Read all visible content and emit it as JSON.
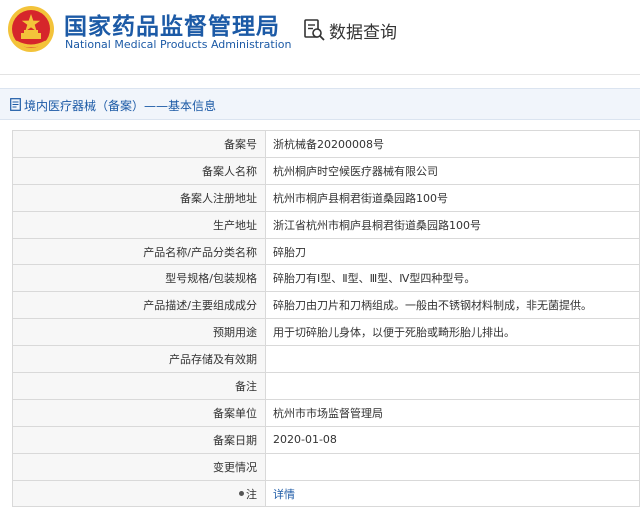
{
  "header": {
    "title_cn": "国家药品监督管理局",
    "title_en": "National Medical Products Administration",
    "query_label": "数据查询"
  },
  "breadcrumb": {
    "text": "境内医疗器械（备案）——基本信息"
  },
  "table": {
    "rows": [
      {
        "label": "备案号",
        "value": "浙杭械备20200008号"
      },
      {
        "label": "备案人名称",
        "value": "杭州桐庐时空候医疗器械有限公司"
      },
      {
        "label": "备案人注册地址",
        "value": "杭州市桐庐县桐君街道桑园路100号"
      },
      {
        "label": "生产地址",
        "value": "浙江省杭州市桐庐县桐君街道桑园路100号"
      },
      {
        "label": "产品名称/产品分类名称",
        "value": "碎胎刀"
      },
      {
        "label": "型号规格/包装规格",
        "value": "碎胎刀有Ⅰ型、Ⅱ型、Ⅲ型、Ⅳ型四种型号。"
      },
      {
        "label": "产品描述/主要组成成分",
        "value": "碎胎刀由刀片和刀柄组成。一般由不锈钢材料制成，非无菌提供。"
      },
      {
        "label": "预期用途",
        "value": "用于切碎胎儿身体，以便于死胎或畸形胎儿排出。"
      },
      {
        "label": "产品存储及有效期",
        "value": ""
      },
      {
        "label": "备注",
        "value": ""
      },
      {
        "label": "备案单位",
        "value": "杭州市市场监督管理局"
      },
      {
        "label": "备案日期",
        "value": "2020-01-08"
      },
      {
        "label": "变更情况",
        "value": ""
      }
    ],
    "note_label": "注",
    "detail_link": "详情"
  },
  "colors": {
    "brand_blue": "#1c5aa6",
    "emblem_red": "#d6262b",
    "emblem_gold": "#f3c33a",
    "label_bg": "#f7f7f7",
    "border": "#d9d9d9"
  }
}
